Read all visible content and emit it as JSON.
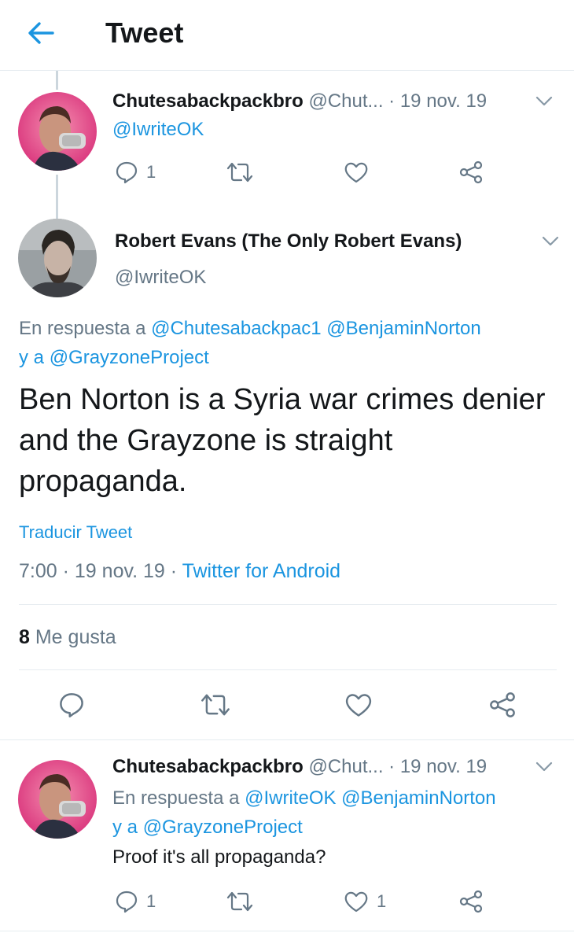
{
  "header": {
    "title": "Tweet"
  },
  "tweet1": {
    "name": "Chutesabackpackbro",
    "handle": "@Chut...",
    "date": "· 19 nov. 19",
    "text": "@IwriteOK",
    "reply_count": "1"
  },
  "main": {
    "name": "Robert Evans (The Only Robert Evans)",
    "handle": "@IwriteOK",
    "reply_prefix": "En respuesta a",
    "reply_mention1": "@Chutesabackpac1",
    "reply_mention2": "@BenjaminNorton",
    "reply_and": "y a",
    "reply_mention3": "@GrayzoneProject",
    "text": "Ben Norton is a Syria war crimes denier and the Grayzone is straight propaganda.",
    "translate": "Traducir Tweet",
    "time": "7:00",
    "date": "19 nov. 19",
    "source": "Twitter for Android",
    "likes_count": "8",
    "likes_label": "Me gusta"
  },
  "tweet3": {
    "name": "Chutesabackpackbro",
    "handle": "@Chut...",
    "date": "· 19 nov. 19",
    "reply_prefix": "En respuesta a",
    "reply_mention1": "@IwriteOK",
    "reply_mention2": "@BenjaminNorton",
    "reply_and": "y a",
    "reply_mention3": "@GrayzoneProject",
    "text": "Proof it's all propaganda?",
    "reply_count": "1",
    "like_count": "1"
  },
  "colors": {
    "accent": "#1b95e0",
    "muted": "#657786",
    "icon": "#657786",
    "border": "#e6ecf0"
  }
}
